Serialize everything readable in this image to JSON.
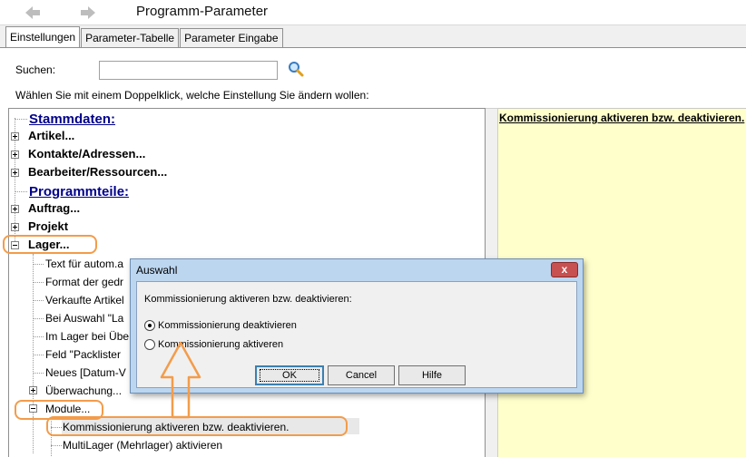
{
  "window": {
    "title": "Programm-Parameter"
  },
  "tabs": [
    "Einstellungen",
    "Parameter-Tabelle",
    "Parameter Eingabe"
  ],
  "search": {
    "label": "Suchen:",
    "value": ""
  },
  "hint": "Wählen Sie mit einem Doppelklick, welche Einstellung Sie ändern wollen:",
  "tree": {
    "section_stammdaten": "Stammdaten:",
    "artikel": "Artikel...",
    "kontakte": "Kontakte/Adressen...",
    "bearbeiter": "Bearbeiter/Ressourcen...",
    "section_programmteile": "Programmteile:",
    "auftrag": "Auftrag...",
    "projekt": "Projekt",
    "lager": "Lager...",
    "lager_children": [
      "Text für autom.a",
      "Format der gedr",
      "Verkaufte Artikel",
      "Bei Auswahl \"La",
      "Im Lager bei Übe",
      "Feld \"Packlister",
      "Neues [Datum-V"
    ],
    "ueberwachung": "Überwachung...",
    "module": "Module...",
    "module_children": [
      "Kommissionierung aktiveren bzw. deaktivieren.",
      "MultiLager (Mehrlager) aktivieren"
    ]
  },
  "info_panel": {
    "text": "Kommissionierung aktiveren bzw. deaktivieren."
  },
  "dialog": {
    "title": "Auswahl",
    "close": "x",
    "prompt": "Kommissionierung aktiveren bzw. deaktivieren:",
    "options": [
      {
        "label": "Kommissionierung deaktivieren",
        "checked": true
      },
      {
        "label": "Kommissionierung aktiveren",
        "checked": false
      }
    ],
    "buttons": {
      "ok": "OK",
      "cancel": "Cancel",
      "help": "Hilfe"
    }
  },
  "colors": {
    "section_heading": "#00008b",
    "info_background": "#ffffcc",
    "annotation": "#f39c4a",
    "dialog_frame": "#bcd6f0"
  }
}
